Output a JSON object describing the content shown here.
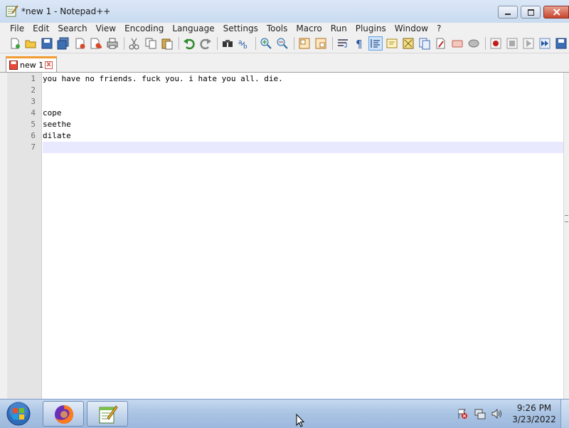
{
  "window": {
    "title": "*new 1 - Notepad++"
  },
  "menu": {
    "items": [
      "File",
      "Edit",
      "Search",
      "View",
      "Encoding",
      "Language",
      "Settings",
      "Tools",
      "Macro",
      "Run",
      "Plugins",
      "Window",
      "?"
    ]
  },
  "toolbar": {
    "icons": [
      "new-file-icon",
      "open-file-icon",
      "save-icon",
      "save-all-icon",
      "close-icon",
      "close-all-icon",
      "print-icon",
      "cut-icon",
      "copy-icon",
      "paste-icon",
      "undo-icon",
      "redo-icon",
      "find-icon",
      "replace-icon",
      "zoom-in-icon",
      "zoom-out-icon",
      "sync-vertical-icon",
      "sync-horizontal-icon",
      "word-wrap-icon",
      "show-all-chars-icon",
      "indent-guide-icon",
      "user-language-icon",
      "doc-map-icon",
      "function-list-icon",
      "folder-workspace-icon",
      "monitoring-icon",
      "record-macro-icon",
      "stop-record-icon",
      "play-macro-icon",
      "run-multiple-icon",
      "save-macro-icon"
    ]
  },
  "tab": {
    "label": "new 1",
    "close_glyph": "x"
  },
  "editor": {
    "lines": [
      {
        "num": "1",
        "text": "you have no friends. fuck you. i hate you all. die."
      },
      {
        "num": "2",
        "text": ""
      },
      {
        "num": "3",
        "text": ""
      },
      {
        "num": "4",
        "text": "cope"
      },
      {
        "num": "5",
        "text": "seethe"
      },
      {
        "num": "6",
        "text": "dilate"
      },
      {
        "num": "7",
        "text": ""
      }
    ],
    "current_line": 7
  },
  "taskbar": {
    "apps": [
      "firefox-icon",
      "notepad-plus-plus-icon"
    ],
    "tray": [
      "action-center-flag-icon",
      "network-icon",
      "volume-icon"
    ],
    "time": "9:26 PM",
    "date": "3/23/2022"
  },
  "colors": {
    "tab_accent": "#f29b2e",
    "current_line": "#e8e8ff",
    "gutter": "#e4e4e4"
  }
}
